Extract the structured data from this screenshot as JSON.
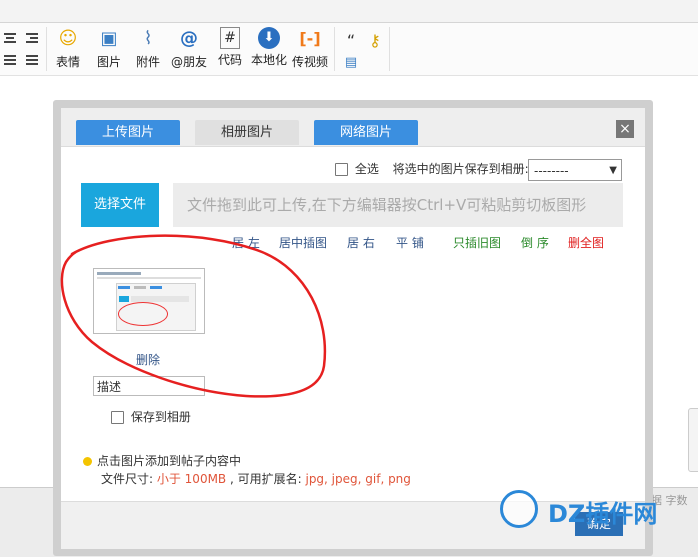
{
  "toolbar": {
    "items": [
      {
        "label": "表情",
        "icon": "smiley-face-icon",
        "glyph": "☺"
      },
      {
        "label": "图片",
        "icon": "picture-icon",
        "glyph": "▣"
      },
      {
        "label": "附件",
        "icon": "paperclip-icon",
        "glyph": "⌇"
      },
      {
        "label": "@朋友",
        "icon": "at-sign-icon",
        "glyph": "@"
      },
      {
        "label": "代码",
        "icon": "code-hash-icon",
        "glyph": "#"
      },
      {
        "label": "本地化",
        "icon": "download-circle-icon",
        "glyph": "⬇"
      },
      {
        "label": "传视频",
        "icon": "video-bracket-icon",
        "glyph": "[-]"
      }
    ],
    "extra": {
      "quote_glyph": "“",
      "key_glyph": "⚷",
      "doc_glyph": "▤"
    }
  },
  "dialog": {
    "tabs": [
      "上传图片",
      "相册图片",
      "网络图片"
    ],
    "close_glyph": "×",
    "select_all_label": "全选",
    "save_to_album_label": "将选中的图片保存到相册:",
    "album_select_value": "--------",
    "choose_file_label": "选择文件",
    "dropzone_text": "文件拖到此可上传,在下方编辑器按Ctrl+V可粘贴剪切板图形",
    "actions": {
      "left": "居 左",
      "center": "居中插图",
      "right": "居 右",
      "tile": "平 铺",
      "insert_old": "只插旧图",
      "reverse": "倒 序",
      "delete_all": "删全图"
    },
    "delete_label": "删除",
    "desc_placeholder": "描述",
    "save_album_checkbox_label": "保存到相册",
    "tip_line1": "点击图片添加到帖子内容中",
    "tip_prefix": "文件尺寸: ",
    "tip_size": "小于 100MB",
    "tip_mid": " , 可用扩展名: ",
    "tip_exts": "jpg, jpeg, gif, png",
    "ok_label": "确定"
  },
  "colors": {
    "tab_blue": "#3b8fe0",
    "choose_blue": "#1aa6dd",
    "link_blue": "#335588",
    "insert_green": "#2b8a2b",
    "delete_red": "#e02020",
    "size_red": "#e0553a",
    "annotation_red": "#e62020"
  },
  "background": {
    "right_ghost_text": "数据 字数"
  },
  "watermark": {
    "text": "DZ插件网"
  }
}
